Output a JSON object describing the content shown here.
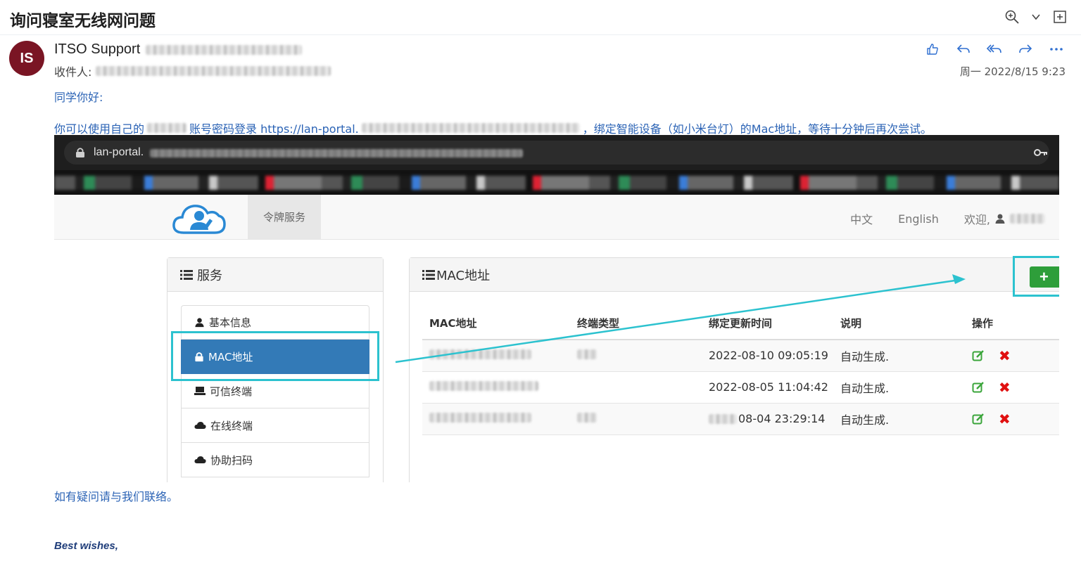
{
  "email": {
    "subject": "询问寝室无线网问题",
    "sender_initials": "IS",
    "sender_name": "ITSO Support",
    "to_label": "收件人:",
    "date": "周一 2022/8/15 9:23"
  },
  "body": {
    "greeting": "同学你好:",
    "para_part1": "你可以使用自己的",
    "para_part2": "账号密码登录 https://lan-portal.",
    "para_part3": "，绑定智能设备（如小米台灯）的Mac地址，等待十分钟后再次尝试。",
    "contact": "如有疑问请与我们联络。",
    "signoff": "Best wishes,"
  },
  "screenshot": {
    "url_prefix": "lan-portal.",
    "token_tab": "令牌服务",
    "lang_zh": "中文",
    "lang_en": "English",
    "welcome": "欢迎,",
    "service_panel_title": "服务",
    "service_items": [
      "基本信息",
      "MAC地址",
      "可信终端",
      "在线终端",
      "协助扫码"
    ],
    "mac_panel_title": "MAC地址",
    "table_headers": [
      "MAC地址",
      "终端类型",
      "绑定更新时间",
      "说明",
      "操作"
    ],
    "rows": [
      {
        "time": "2022-08-10 09:05:19",
        "note": "自动生成."
      },
      {
        "time": "2022-08-05 11:04:42",
        "note": "自动生成."
      },
      {
        "time": "08-04 23:29:14",
        "note": "自动生成."
      }
    ]
  },
  "colors": {
    "accent": "#337ab7",
    "highlight": "#2cc2cf",
    "link_text": "#2b63b5",
    "avatar": "#7a1524",
    "add_button": "#2e9e3a",
    "delete": "#e01010"
  }
}
